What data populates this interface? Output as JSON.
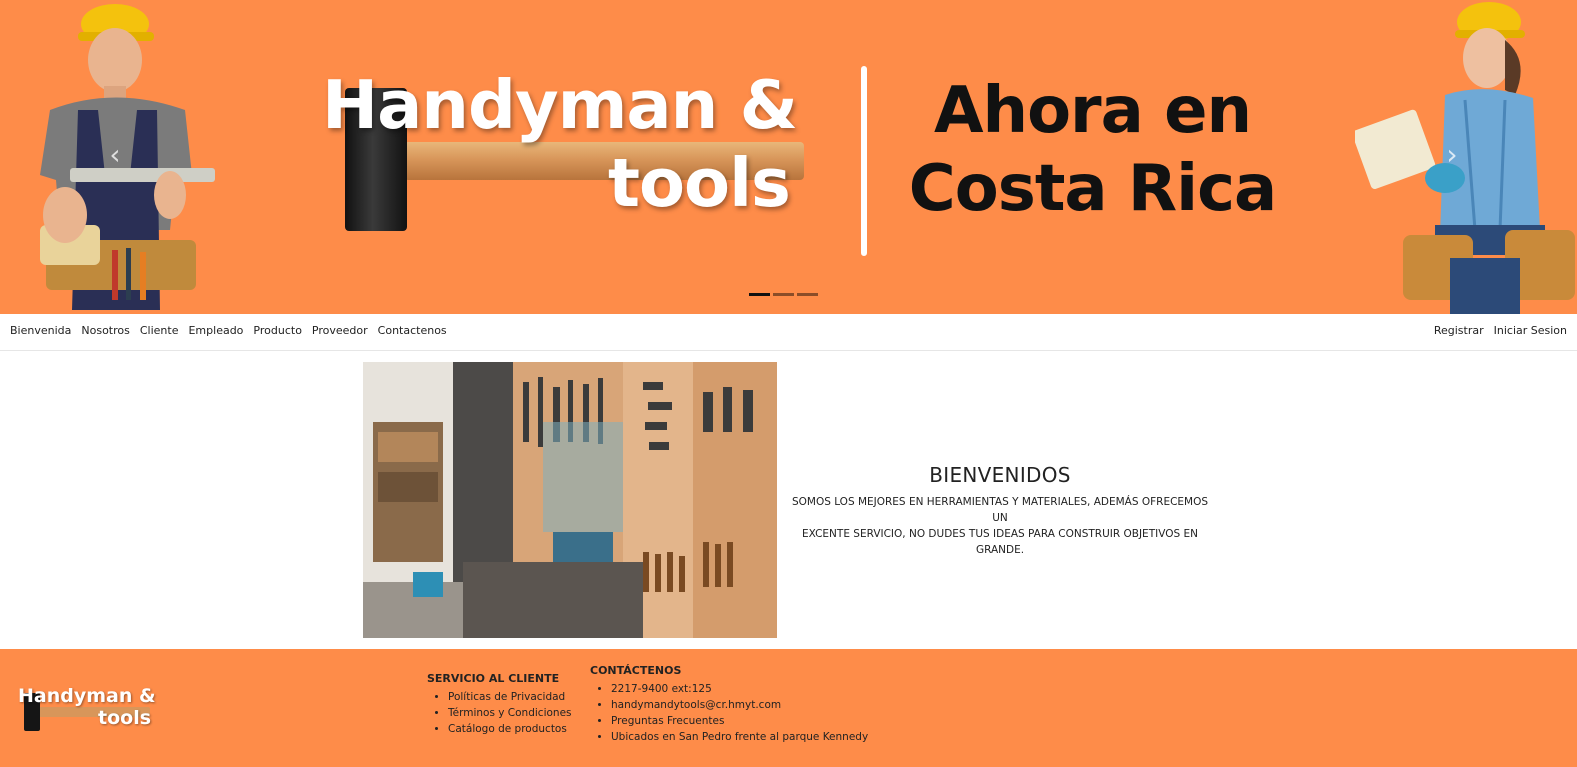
{
  "hero": {
    "title_line1": "Handyman &",
    "title_line2": "tools",
    "tagline_line1": "Ahora en",
    "tagline_line2": "Costa Rica",
    "prev_icon": "chevron-left-icon",
    "next_icon": "chevron-right-icon",
    "slide_count": 3,
    "active_slide": 1,
    "background_color": "#fe8c49"
  },
  "nav": {
    "left_items": [
      "Bienvenida",
      "Nosotros",
      "Cliente",
      "Empleado",
      "Producto",
      "Proveedor",
      "Contactenos"
    ],
    "right_items": [
      "Registrar",
      "Iniciar Sesion"
    ]
  },
  "welcome": {
    "title": "BIENVENIDOS",
    "text_line1": "SOMOS LOS MEJORES EN HERRAMIENTAS Y MATERIALES, ADEMÁS OFRECEMOS UN",
    "text_line2": "EXCENTE SERVICIO, NO DUDES TUS IDEAS PARA CONSTRUIR OBJETIVOS EN GRANDE."
  },
  "footer": {
    "logo_line1": "Handyman &",
    "logo_line2": "tools",
    "service": {
      "heading": "SERVICIO AL CLIENTE",
      "items": [
        "Políticas de Privacidad",
        "Términos y Condiciones",
        "Catálogo de productos"
      ]
    },
    "contact": {
      "heading": "CONTÁCTENOS",
      "items": [
        "2217-9400 ext:125",
        "handymandytools@cr.hmyt.com",
        "Preguntas Frecuentes",
        "Ubicados en San Pedro frente al parque Kennedy"
      ]
    },
    "background_color": "#fe8c49"
  }
}
